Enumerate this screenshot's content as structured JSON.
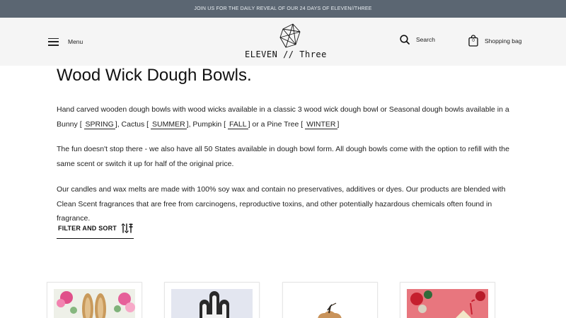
{
  "announcement": "JOIN US FOR THE DAILY REVEAL OF OUR 24 DAYS OF ELEVEN//THREE",
  "header": {
    "menu_label": "Menu",
    "logo_text": "ELEVEN // Three",
    "search_label": "Search",
    "bag_label": "Shopping bag",
    "bag_count": "0"
  },
  "main": {
    "title": "Wood Wick Dough Bowls.",
    "intro_1": "Hand carved wooden dough bowls with wood wicks available in a classic 3 wood wick dough bowl or Seasonal dough bowls available in a Bunny [",
    "tag_spring": "SPRING",
    "intro_2": "], Cactus [",
    "tag_summer": "SUMMER",
    "intro_3": "], Pumpkin [",
    "tag_fall": "FALL",
    "intro_4": "] or a Pine Tree [",
    "tag_winter": "WINTER",
    "intro_5": "]",
    "para_2": "The fun doesn't stop there - we also have all 50 States available in dough bowl form. All dough bowls come with the option to refill with the same scent or switch it up for half of the original price.",
    "para_3": "Our candles and wax melts are made with 100% soy wax and contain no preservatives, additives or dyes. Our products are blended with Clean Scent fragrances that are free from carcinogens, reproductive toxins, and other potentially hazardous chemicals often found in fragrance.",
    "filter_label": "FILTER AND SORT"
  },
  "products": [
    {
      "icon": "bunny-dough-bowl-image"
    },
    {
      "icon": "cactus-dough-bowl-image"
    },
    {
      "icon": "pumpkin-dough-bowl-image"
    },
    {
      "icon": "pine-tree-dough-bowl-image"
    }
  ],
  "colors": {
    "announcement_bg": "#5b6672",
    "header_bg": "#f5f5f5",
    "text": "#222222"
  }
}
